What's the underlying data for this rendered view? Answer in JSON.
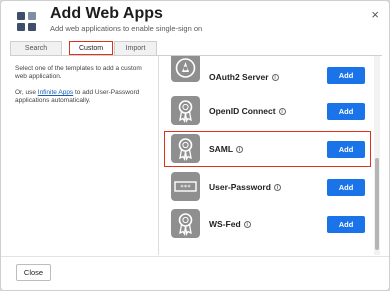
{
  "dialog": {
    "title": "Add Web Apps",
    "subtitle": "Add web applications to enable single-sign on",
    "close_glyph": "×"
  },
  "tabs": [
    {
      "label": "Search",
      "selected": false
    },
    {
      "label": "Custom",
      "selected": true
    },
    {
      "label": "Import",
      "selected": false
    }
  ],
  "left_panel": {
    "intro": "Select one of the templates to add a custom web application.",
    "or_text": "Or, use ",
    "link_text": "Infinite Apps",
    "after_link": " to add User-Password applications automatically."
  },
  "templates": [
    {
      "name": "OAuth2 Server",
      "button": "Add",
      "icon": "oauth-badge-icon",
      "highlighted": false
    },
    {
      "name": "OpenID Connect",
      "button": "Add",
      "icon": "ribbon-badge-icon",
      "highlighted": false
    },
    {
      "name": "SAML",
      "button": "Add",
      "icon": "ribbon-badge-icon",
      "highlighted": true
    },
    {
      "name": "User-Password",
      "button": "Add",
      "icon": "password-field-icon",
      "highlighted": false
    },
    {
      "name": "WS-Fed",
      "button": "Add",
      "icon": "ribbon-badge-icon",
      "highlighted": false
    }
  ],
  "footer": {
    "close_label": "Close"
  },
  "colors": {
    "accent": "#1a73e8",
    "highlight": "#e0301e",
    "logo_bg": "#8f8f8f"
  }
}
